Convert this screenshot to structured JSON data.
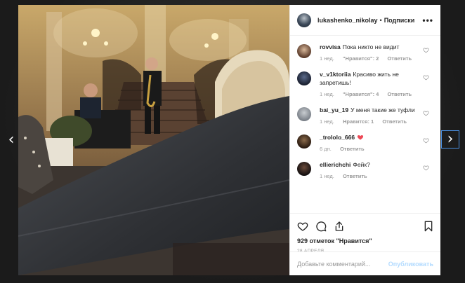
{
  "colors": {
    "text": "#262626",
    "muted": "#999999",
    "accent_disabled": "#b3dbff",
    "heart_red": "#ed4956"
  },
  "nav": {
    "prev_icon": "chevron-left-icon",
    "next_icon": "chevron-right-icon",
    "prev_glyph": "‹",
    "next_glyph": "›"
  },
  "header": {
    "username": "lukashenko_nikolay",
    "separator": "•",
    "follow_status": "Подписки",
    "more_glyph": "•••"
  },
  "comments": [
    {
      "username": "rovvisa",
      "text": "Пока никто не видит",
      "time": "1 нед.",
      "likes": "\"Нравится\": 2",
      "reply": "Ответить"
    },
    {
      "username": "v_v1ktoriia",
      "text": "Красиво жить не запретишь!",
      "time": "1 нед.",
      "likes": "\"Нравится\": 4",
      "reply": "Ответить"
    },
    {
      "username": "bai_yu_19",
      "text": "У меня такие же туфли",
      "time": "1 нед.",
      "likes": "Нравится: 1",
      "reply": "Ответить"
    },
    {
      "username": "_trololo_666",
      "text": "",
      "emoji": "heart",
      "time": "6 дн.",
      "reply": "Ответить"
    },
    {
      "username": "ellierichchi",
      "text": "Фейк?",
      "time": "1 нед.",
      "reply": "Ответить"
    }
  ],
  "post": {
    "likes": "929 отметок \"Нравится\"",
    "date": "28 АПРЕЛЯ"
  },
  "comment_box": {
    "placeholder": "Добавьте комментарий...",
    "publish_label": "Опубликовать"
  }
}
